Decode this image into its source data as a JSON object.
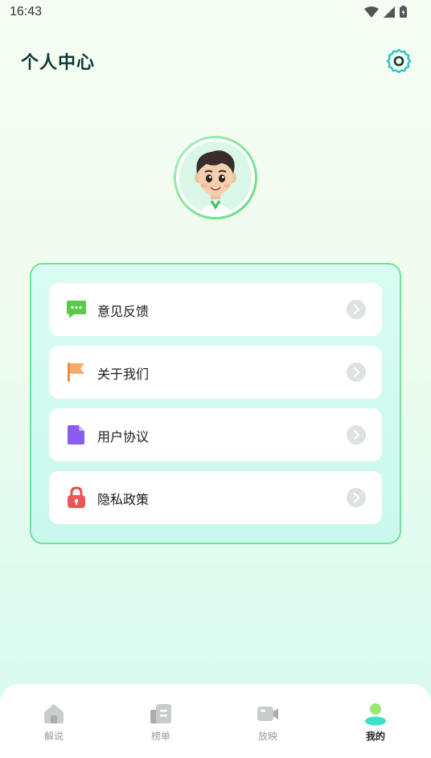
{
  "status_bar": {
    "time": "16:43"
  },
  "header": {
    "title": "个人中心",
    "settings_icon": "gear-icon"
  },
  "profile": {
    "avatar": "cartoon-boy-avatar"
  },
  "menu": {
    "items": [
      {
        "label": "意见反馈",
        "icon": "message-icon",
        "icon_color": "#5cc84a"
      },
      {
        "label": "关于我们",
        "icon": "flag-icon",
        "icon_color": "#f59a4d"
      },
      {
        "label": "用户协议",
        "icon": "document-icon",
        "icon_color": "#8b5cf0"
      },
      {
        "label": "隐私政策",
        "icon": "lock-icon",
        "icon_color": "#f0494b"
      }
    ]
  },
  "bottom_nav": {
    "tabs": [
      {
        "label": "解说",
        "icon": "home-icon",
        "active": false
      },
      {
        "label": "榜单",
        "icon": "list-icon",
        "active": false
      },
      {
        "label": "放映",
        "icon": "video-icon",
        "active": false
      },
      {
        "label": "我的",
        "icon": "profile-icon",
        "active": true
      }
    ]
  },
  "colors": {
    "accent": "#63d97a",
    "title": "#0e3b36",
    "arrow_bg": "#dce3e2"
  }
}
